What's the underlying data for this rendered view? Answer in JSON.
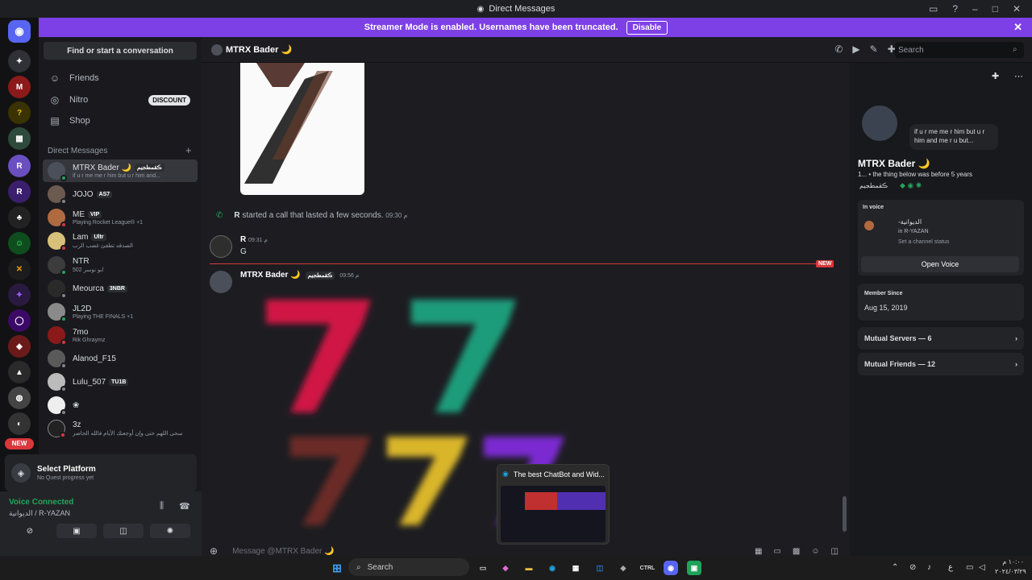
{
  "window": {
    "title": "Direct Messages"
  },
  "banner": {
    "text": "Streamer Mode is enabled. Usernames have been truncated.",
    "button": "Disable"
  },
  "sidebar": {
    "search_label": "Find or start a conversation",
    "nav": [
      {
        "label": "Friends",
        "icon": "friends-icon"
      },
      {
        "label": "Nitro",
        "icon": "nitro-icon",
        "badge": "DISCOUNT"
      },
      {
        "label": "Shop",
        "icon": "shop-icon"
      }
    ],
    "dm_header": "Direct Messages",
    "dms": [
      {
        "name": "MTRX Bader 🌙",
        "tag": "ڪقمطجيم",
        "sub": "if u r me me r him but u r him and...",
        "active": true
      },
      {
        "name": "JOJO",
        "tag": "AS7",
        "sub": ""
      },
      {
        "name": "ME",
        "tag": "VIP",
        "sub": "Playing Rocket League® +1"
      },
      {
        "name": "Lam",
        "tag": "Ultr",
        "sub": "الصدقه تطفئ غضب الرب"
      },
      {
        "name": "NTR",
        "tag": "",
        "sub": "ابو نوسر 502"
      },
      {
        "name": "Meourca",
        "tag": "3NBR",
        "sub": ""
      },
      {
        "name": "JL2D",
        "tag": "",
        "sub": "Playing THE FINALS +1"
      },
      {
        "name": "7mo",
        "tag": "",
        "sub": "Rik Ghraymz"
      },
      {
        "name": "Alanod_F15",
        "tag": "",
        "sub": ""
      },
      {
        "name": "Lulu_507",
        "tag": "TU1B",
        "sub": ""
      },
      {
        "name": "❀",
        "tag": "",
        "sub": ""
      },
      {
        "name": "3z",
        "tag": "",
        "sub": "سحى اللهم حتى وإن أوجعتك الأيام فالله الحاضر"
      }
    ],
    "quest": {
      "title": "Select Platform",
      "sub": "No Quest progress yet"
    },
    "voice": {
      "status": "Voice Connected",
      "channel": "الديوانية / R-YAZAN"
    }
  },
  "guilds": {
    "new_badge": "NEW"
  },
  "chat": {
    "header_name": "MTRX Bader 🌙",
    "search_placeholder": "Search",
    "call_text": "started a call that lasted a few seconds.",
    "call_user": "R",
    "call_time": "09:30 م",
    "msg1": {
      "author": "R",
      "time": "09:31 م",
      "text": "G"
    },
    "new_label": "NEW",
    "msg2": {
      "author": "MTRX Bader 🌙",
      "tag": "ڪقمطجيم",
      "time": "09:56 م"
    },
    "composer_placeholder": "Message @MTRX Bader 🌙"
  },
  "profile": {
    "status_bubble": "if u r me me r him but u r him and me r u but...",
    "name": "MTRX Bader 🌙",
    "bio": "1... • the thing below was before 5 years",
    "tag": "ڪقمطجيم",
    "in_voice_label": "In voice",
    "voice_name": "-الديوانية",
    "voice_server": "in R-YAZAN",
    "set_status": "Set a channel status",
    "open_voice": "Open Voice",
    "member_since_label": "Member Since",
    "member_since": "Aug 15, 2019",
    "mutual_servers": "Mutual Servers — 6",
    "mutual_friends": "Mutual Friends — 12"
  },
  "thumbnail": {
    "title": "The best ChatBot and Wid..."
  },
  "taskbar": {
    "search": "Search",
    "lang": "ع",
    "time": "١٠:٠٠ م",
    "date": "٢٠٢٤/٠٣/٢٩"
  }
}
